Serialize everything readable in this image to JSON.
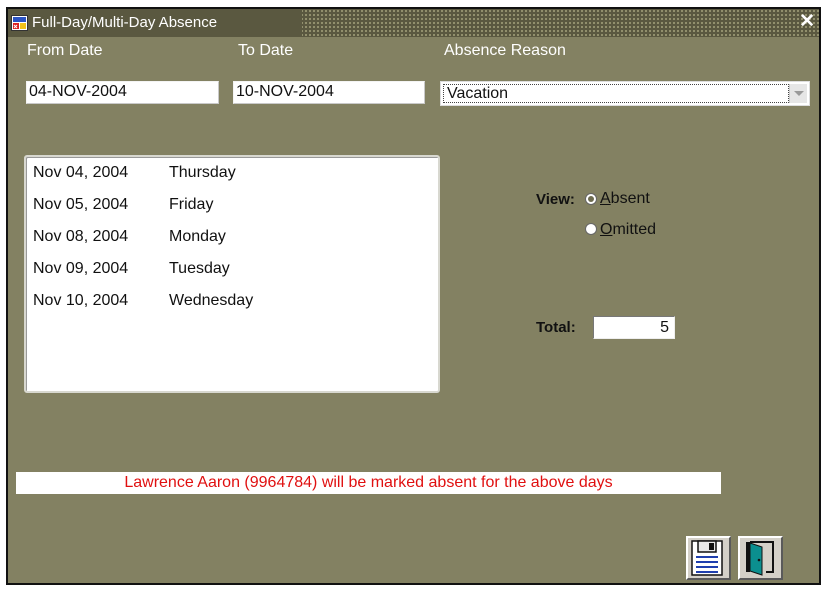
{
  "window": {
    "title": "Full-Day/Multi-Day Absence"
  },
  "form": {
    "from_date_label": "From Date",
    "from_date_value": "04-NOV-2004",
    "to_date_label": "To Date",
    "to_date_value": "10-NOV-2004",
    "absence_reason_label": "Absence Reason",
    "absence_reason_value": "Vacation"
  },
  "days": [
    {
      "date": "Nov 04, 2004",
      "weekday": "Thursday"
    },
    {
      "date": "Nov 05, 2004",
      "weekday": "Friday"
    },
    {
      "date": "Nov 08, 2004",
      "weekday": "Monday"
    },
    {
      "date": "Nov 09, 2004",
      "weekday": "Tuesday"
    },
    {
      "date": "Nov 10, 2004",
      "weekday": "Wednesday"
    }
  ],
  "view": {
    "label": "View:",
    "options": [
      {
        "label_first": "A",
        "label_rest": "bsent",
        "selected": true
      },
      {
        "label_first": "O",
        "label_rest": "mitted",
        "selected": false
      }
    ]
  },
  "total": {
    "label": "Total:",
    "value": "5"
  },
  "message": "Lawrence Aaron (9964784)  will be marked absent for the above days",
  "toolbar": {
    "save_icon": "save-icon",
    "exit_icon": "exit-door-icon"
  },
  "colors": {
    "window_bg": "#838162",
    "message_text": "#e01010"
  }
}
